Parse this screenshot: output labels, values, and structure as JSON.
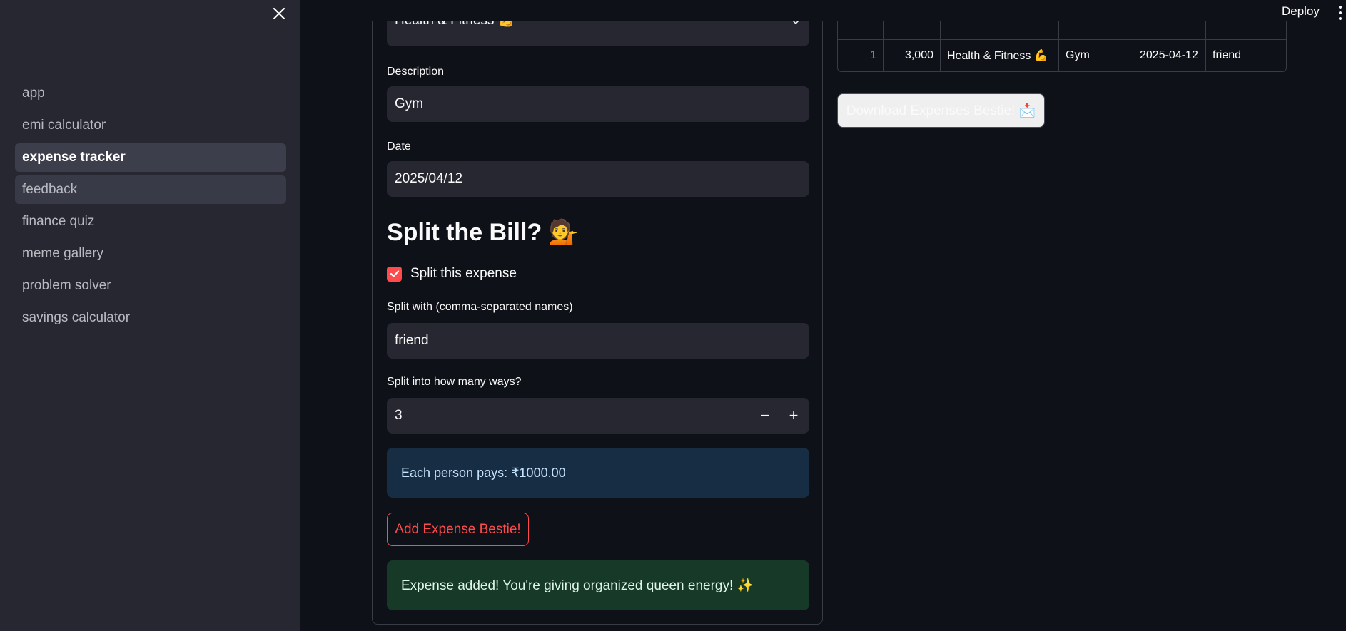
{
  "header": {
    "deploy_label": "Deploy"
  },
  "sidebar": {
    "items": [
      {
        "label": "app"
      },
      {
        "label": "emi calculator"
      },
      {
        "label": "expense tracker"
      },
      {
        "label": "feedback"
      },
      {
        "label": "finance quiz"
      },
      {
        "label": "meme gallery"
      },
      {
        "label": "problem solver"
      },
      {
        "label": "savings calculator"
      }
    ],
    "active_item": "expense tracker"
  },
  "form": {
    "category_value": "Health & Fitness 💪",
    "description_label": "Description",
    "description_value": "Gym",
    "date_label": "Date",
    "date_value": "2025/04/12",
    "split_heading": "Split the Bill? 💁",
    "split_checkbox_label": "Split this expense",
    "split_checked": true,
    "split_with_label": "Split with (comma-separated names)",
    "split_with_value": "friend",
    "split_ways_label": "Split into how many ways?",
    "split_ways_value": "3",
    "stepper_minus": "−",
    "stepper_plus": "+",
    "info_message": "Each person pays: ₹1000.00",
    "add_button_label": "Add Expense Bestie!",
    "success_message": "Expense added! You're giving organized queen energy! ✨"
  },
  "table": {
    "rows": [
      {
        "index": "1",
        "amount": "3,000",
        "category": "Health & Fitness 💪",
        "description": "Gym",
        "date": "2025-04-12",
        "split_with": "friend"
      }
    ]
  },
  "download_button_label": "Download Expenses Bestie! 📩",
  "colors": {
    "accent": "#ff4b4b",
    "background": "#0e1117",
    "sidebar": "#262730",
    "info_bg": "#172d43",
    "success_bg": "#173928"
  }
}
